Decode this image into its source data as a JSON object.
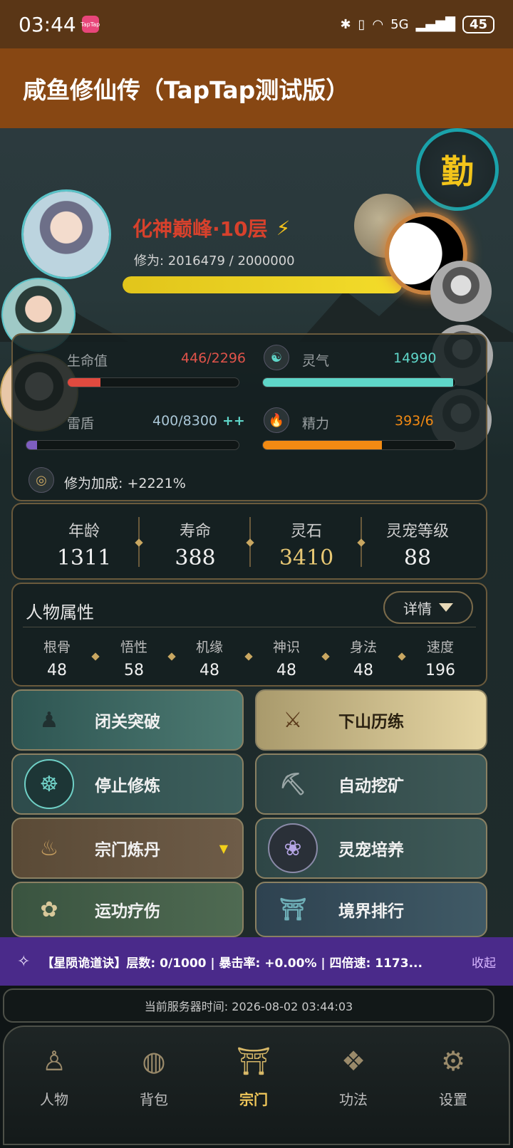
{
  "status_bar": {
    "time": "03:44",
    "app_badge": "TapTap",
    "battery": "45",
    "network": "5G"
  },
  "app": {
    "title": "咸鱼修仙传（TapTap测试版）"
  },
  "hero": {
    "diligence_badge": "勤",
    "realm": "化神巅峰·10层",
    "cultivation_label": "修为: 2016479 / 2000000",
    "cultivation_progress": 1.0
  },
  "stats": {
    "hp": {
      "label": "生命值",
      "value": "446/2296",
      "progress": 0.19,
      "color": "#e04a3f"
    },
    "spirit": {
      "label": "灵气",
      "value": "14990",
      "progress": 0.99,
      "color": "#5fd6c9"
    },
    "shield": {
      "label": "雷盾",
      "value": "400/8300",
      "extra": "++",
      "progress": 0.05,
      "color": "#7e5ec0"
    },
    "energy": {
      "label": "精力",
      "value": "393/6",
      "progress": 0.62,
      "color": "#f28a13"
    },
    "bonus": "修为加成: +2221%"
  },
  "info": [
    {
      "label": "年龄",
      "value": "1311"
    },
    {
      "label": "寿命",
      "value": "388"
    },
    {
      "label": "灵石",
      "value": "3410"
    },
    {
      "label": "灵宠等级",
      "value": "88"
    }
  ],
  "attributes": {
    "title": "人物属性",
    "detail_label": "详情",
    "items": [
      {
        "label": "根骨",
        "value": "48"
      },
      {
        "label": "悟性",
        "value": "58"
      },
      {
        "label": "机缘",
        "value": "48"
      },
      {
        "label": "神识",
        "value": "48"
      },
      {
        "label": "身法",
        "value": "48"
      },
      {
        "label": "速度",
        "value": "196"
      }
    ]
  },
  "actions": [
    {
      "label": "闭关突破",
      "icon": "meditate-icon"
    },
    {
      "label": "下山历练",
      "icon": "warrior-icon"
    },
    {
      "label": "停止修炼",
      "icon": "lotus-pose-icon"
    },
    {
      "label": "自动挖矿",
      "icon": "pickaxe-icon"
    },
    {
      "label": "宗门炼丹",
      "icon": "cauldron-icon"
    },
    {
      "label": "灵宠培养",
      "icon": "paw-icon"
    },
    {
      "label": "运功疗伤",
      "icon": "lotus-icon"
    },
    {
      "label": "境界排行",
      "icon": "pagoda-icon"
    }
  ],
  "marquee": {
    "text": "【星陨诡道诀】层数: 0/1000 | 暴击率: +0.00% | 四倍速: 1173...",
    "collapse_label": "收起"
  },
  "server_time": "当前服务器时间: 2026-08-02 03:44:03",
  "nav": [
    {
      "label": "人物",
      "icon": "person-icon"
    },
    {
      "label": "背包",
      "icon": "bag-icon"
    },
    {
      "label": "宗门",
      "icon": "temple-icon",
      "active": true
    },
    {
      "label": "功法",
      "icon": "scroll-icon"
    },
    {
      "label": "设置",
      "icon": "gear-icon"
    }
  ]
}
